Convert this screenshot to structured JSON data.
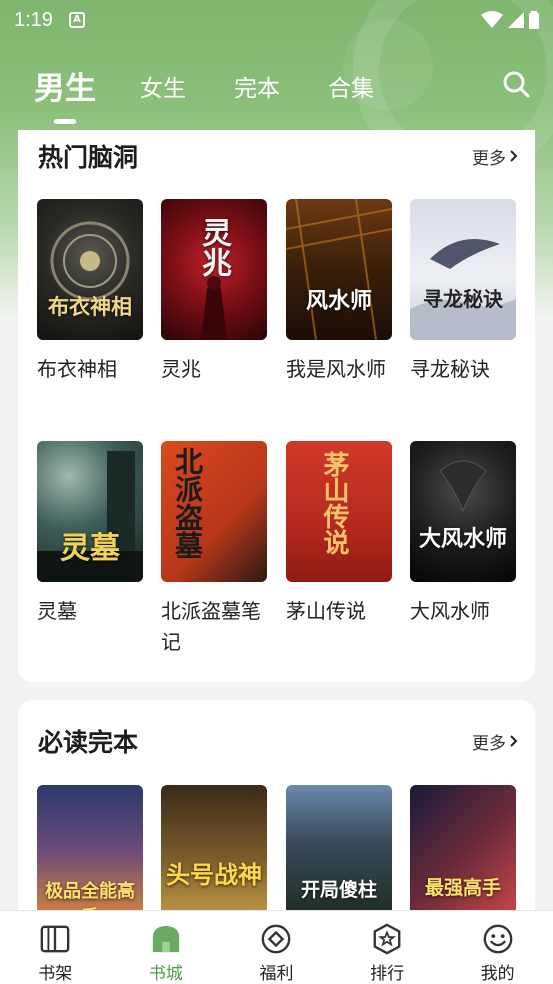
{
  "status_bar": {
    "time": "1:19",
    "notif_icon": "A"
  },
  "top_tabs": [
    {
      "label": "男生",
      "active": true
    },
    {
      "label": "女生",
      "active": false
    },
    {
      "label": "完本",
      "active": false
    },
    {
      "label": "合集",
      "active": false
    }
  ],
  "hot_section": {
    "title": "热门脑洞",
    "more": "更多",
    "books": [
      {
        "title": "布衣神相",
        "cover_text": "布衣神相"
      },
      {
        "title": "灵兆",
        "cover_text": "灵兆"
      },
      {
        "title": "我是风水师",
        "cover_text": "风水师"
      },
      {
        "title": "寻龙秘诀",
        "cover_text": "寻龙秘诀"
      },
      {
        "title": "灵墓",
        "cover_text": "灵墓"
      },
      {
        "title": "北派盗墓笔记",
        "cover_text": "北派盗墓"
      },
      {
        "title": "茅山传说",
        "cover_text": "茅山传说"
      },
      {
        "title": "大风水师",
        "cover_text": "大风水师"
      }
    ]
  },
  "must_section": {
    "title": "必读完本",
    "more": "更多",
    "books": [
      {
        "cover_text": "极品全能高手"
      },
      {
        "cover_text": "头号战神"
      },
      {
        "cover_text": "开局傻柱"
      },
      {
        "cover_text": "最强高手"
      }
    ]
  },
  "bottom_nav": [
    {
      "label": "书架",
      "active": false
    },
    {
      "label": "书城",
      "active": true
    },
    {
      "label": "福利",
      "active": false
    },
    {
      "label": "排行",
      "active": false
    },
    {
      "label": "我的",
      "active": false
    }
  ],
  "colors": {
    "accent": "#4f9a4a",
    "header_green": "#7fb56f"
  }
}
